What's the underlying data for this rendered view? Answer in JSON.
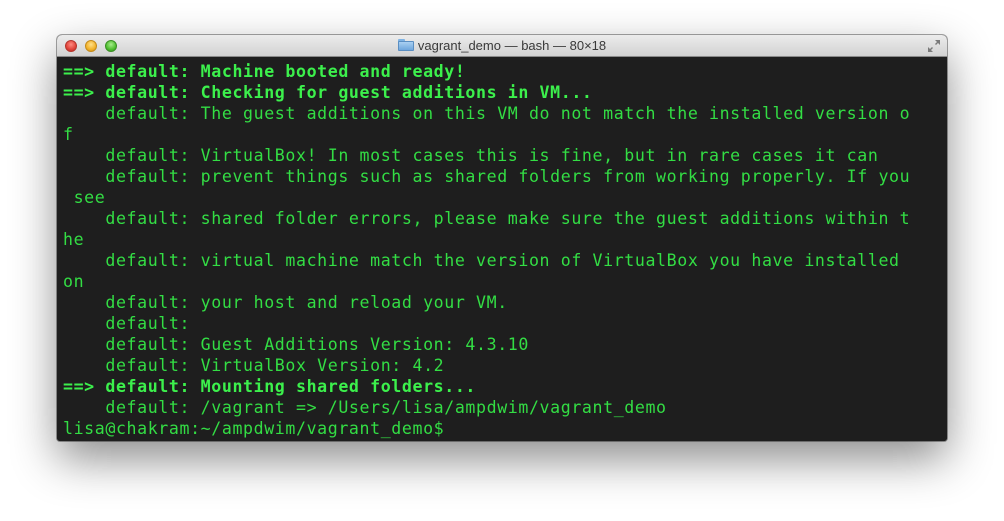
{
  "window": {
    "title": "vagrant_demo — bash — 80×18",
    "colors": {
      "terminal_background": "#1e1e1e",
      "terminal_text": "#33dd44"
    }
  },
  "terminal": {
    "lines": [
      {
        "text": "==> default: Machine booted and ready!",
        "bold": true
      },
      {
        "text": "==> default: Checking for guest additions in VM...",
        "bold": true
      },
      {
        "text": "    default: The guest additions on this VM do not match the installed version o",
        "bold": false
      },
      {
        "text": "f",
        "bold": false
      },
      {
        "text": "    default: VirtualBox! In most cases this is fine, but in rare cases it can",
        "bold": false
      },
      {
        "text": "    default: prevent things such as shared folders from working properly. If you",
        "bold": false
      },
      {
        "text": " see",
        "bold": false
      },
      {
        "text": "    default: shared folder errors, please make sure the guest additions within t",
        "bold": false
      },
      {
        "text": "he",
        "bold": false
      },
      {
        "text": "    default: virtual machine match the version of VirtualBox you have installed",
        "bold": false
      },
      {
        "text": "on",
        "bold": false
      },
      {
        "text": "    default: your host and reload your VM.",
        "bold": false
      },
      {
        "text": "    default:",
        "bold": false
      },
      {
        "text": "    default: Guest Additions Version: 4.3.10",
        "bold": false
      },
      {
        "text": "    default: VirtualBox Version: 4.2",
        "bold": false
      },
      {
        "text": "==> default: Mounting shared folders...",
        "bold": true
      },
      {
        "text": "    default: /vagrant => /Users/lisa/ampdwim/vagrant_demo",
        "bold": false
      },
      {
        "text": "lisa@chakram:~/ampdwim/vagrant_demo$",
        "bold": false
      }
    ]
  }
}
